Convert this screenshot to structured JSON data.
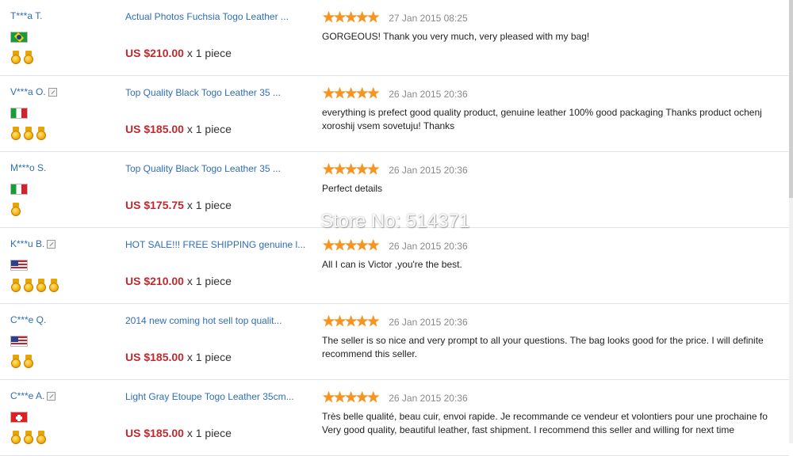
{
  "store_watermark": "Store No: 514371",
  "reviews": [
    {
      "buyer": "T***a T.",
      "verified": false,
      "flag": "br",
      "medals": 2,
      "product": "Actual Photos Fuchsia Togo Leather ...",
      "price": "US $210.00",
      "qty": "x 1 piece",
      "stars": 5,
      "date": "27 Jan 2015 08:25",
      "text": [
        "GORGEOUS! Thank you very much, very pleased with my bag!"
      ]
    },
    {
      "buyer": "V***a O.",
      "verified": true,
      "flag": "it",
      "medals": 3,
      "product": "Top Quality Black Togo Leather 35 ...",
      "price": "US $185.00",
      "qty": "x 1 piece",
      "stars": 5,
      "date": "26 Jan 2015 20:36",
      "text": [
        "everything is prefect good quality product, genuine leather 100% good packaging Thanks product ochenj",
        "xoroshij vsem sovetuju! Thanks"
      ]
    },
    {
      "buyer": "M***o S.",
      "verified": false,
      "flag": "it",
      "medals": 1,
      "product": "Top Quality Black Togo Leather 35 ...",
      "price": "US $175.75",
      "qty": "x 1 piece",
      "stars": 5,
      "date": "26 Jan 2015 20:36",
      "text": [
        "Perfect details"
      ]
    },
    {
      "buyer": "K***u B.",
      "verified": true,
      "flag": "us",
      "medals": 4,
      "product": "HOT SALE!!! FREE SHIPPING genuine l...",
      "price": "US $210.00",
      "qty": "x 1 piece",
      "stars": 5,
      "date": "26 Jan 2015 20:36",
      "text": [
        "All I can is Victor ,you're the best."
      ]
    },
    {
      "buyer": "C***e Q.",
      "verified": false,
      "flag": "us",
      "medals": 2,
      "product": "2014 new coming hot sell top qualit...",
      "price": "US $185.00",
      "qty": "x 1 piece",
      "stars": 5,
      "date": "26 Jan 2015 20:36",
      "text": [
        "The seller is so nice and very prompt to all your questions. The bag looks good for the price. I will definite",
        "recommend this seller."
      ]
    },
    {
      "buyer": "C***e A.",
      "verified": true,
      "flag": "ch",
      "medals": 3,
      "product": "Light Gray Etoupe Togo Leather 35cm...",
      "price": "US $185.00",
      "qty": "x 1 piece",
      "stars": 5,
      "date": "26 Jan 2015 20:36",
      "text": [
        "Très belle qualité, beau cuir, envoi rapide. Je recommande ce vendeur et volontiers pour une prochaine fo",
        "Very good quality, beautiful leather, fast shipment. I recommend this seller and willing for next time"
      ]
    }
  ],
  "icons": {
    "verified": "verified-buyer-icon",
    "medal": "medal-icon",
    "star": "star-icon"
  },
  "colors": {
    "link": "#2f6eb5",
    "price": "#c0282d",
    "star": "#f7941d"
  }
}
